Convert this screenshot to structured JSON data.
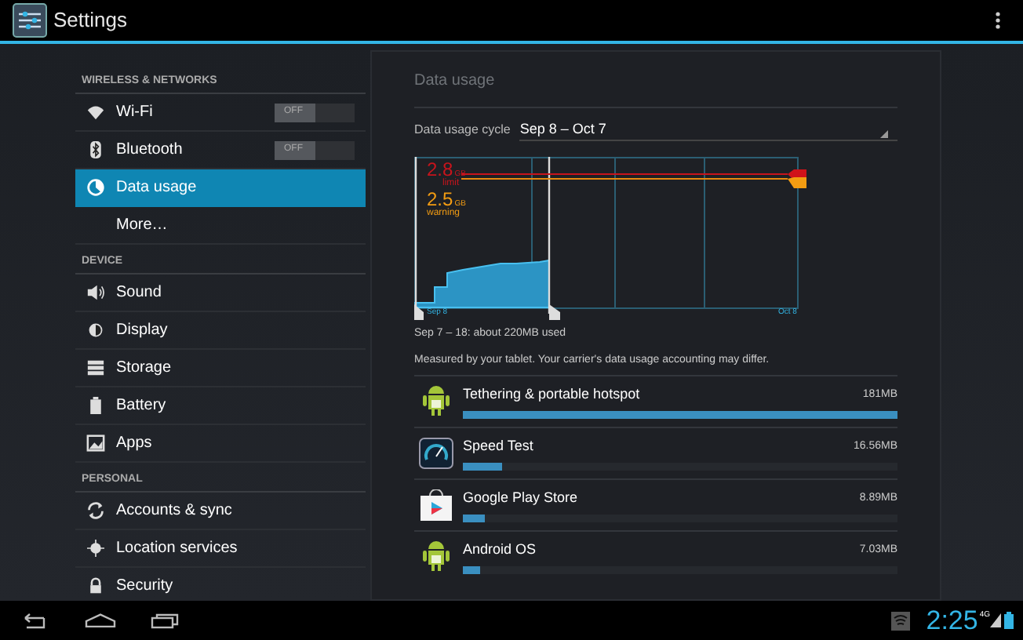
{
  "action_bar": {
    "title": "Settings"
  },
  "sidebar": {
    "sections": [
      {
        "header": "WIRELESS & NETWORKS",
        "items": [
          {
            "kind": "toggle",
            "label": "Wi-Fi",
            "toggle": "OFF",
            "on": false,
            "selected": false
          },
          {
            "kind": "toggle",
            "label": "Bluetooth",
            "toggle": "OFF",
            "on": false,
            "selected": false
          },
          {
            "kind": "plain",
            "label": "Data usage",
            "selected": true
          },
          {
            "kind": "plain",
            "label": "More…",
            "selected": false
          }
        ]
      },
      {
        "header": "DEVICE",
        "items": [
          {
            "kind": "plain",
            "label": "Sound",
            "selected": false
          },
          {
            "kind": "plain",
            "label": "Display",
            "selected": false
          },
          {
            "kind": "plain",
            "label": "Storage",
            "selected": false
          },
          {
            "kind": "plain",
            "label": "Battery",
            "selected": false
          },
          {
            "kind": "plain",
            "label": "Apps",
            "selected": false
          }
        ]
      },
      {
        "header": "PERSONAL",
        "items": [
          {
            "kind": "plain",
            "label": "Accounts & sync",
            "selected": false
          },
          {
            "kind": "plain",
            "label": "Location services",
            "selected": false
          },
          {
            "kind": "plain",
            "label": "Security",
            "selected": false
          }
        ]
      }
    ]
  },
  "panel": {
    "title": "Data usage",
    "cycle_label": "Data usage cycle",
    "cycle_value": "Sep 8 – Oct 7",
    "chart": {
      "limit_value": "2.8",
      "limit_unit": "GB",
      "limit_label": "limit",
      "warning_value": "2.5",
      "warning_unit": "GB",
      "warning_label": "warning",
      "start_label": "Sep 8",
      "end_label": "Oct 8"
    },
    "summary": "Sep 7 – 18: about 220MB used",
    "note": "Measured by your tablet. Your carrier's data usage accounting may differ.",
    "apps": [
      {
        "name": "Tethering & portable hotspot",
        "size": "181MB",
        "level": 1
      },
      {
        "name": "Speed Test",
        "size": "16.56MB",
        "level": 0.092
      },
      {
        "name": "Google Play Store",
        "size": "8.89MB",
        "level": 0.049
      },
      {
        "name": "Android OS",
        "size": "7.03MB",
        "level": 0.039
      }
    ]
  },
  "status_bar": {
    "time": "2:25",
    "network": "4G"
  }
}
